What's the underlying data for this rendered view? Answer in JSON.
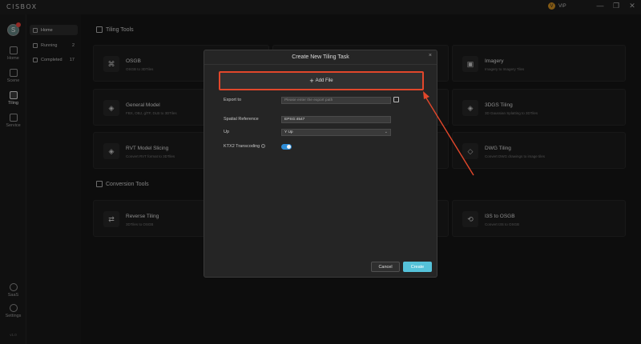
{
  "app": {
    "logo": "CISBOX",
    "vip": "VIP",
    "vip_badge": "V",
    "version": "v1.0"
  },
  "window_controls": [
    "—",
    "❐",
    "✕"
  ],
  "avatar_initial": "S",
  "rail": [
    {
      "label": "Home",
      "icon": "home-icon"
    },
    {
      "label": "Scene",
      "icon": "scene-icon"
    },
    {
      "label": "Tiling",
      "icon": "tiling-icon",
      "active": true
    },
    {
      "label": "Service",
      "icon": "service-icon"
    },
    {
      "label": "SaaS",
      "icon": "saas-icon"
    },
    {
      "label": "Settings",
      "icon": "settings-icon"
    }
  ],
  "subnav": [
    {
      "label": "Home",
      "count": ""
    },
    {
      "label": "Running",
      "count": "2"
    },
    {
      "label": "Completed",
      "count": "17"
    }
  ],
  "sections": {
    "tiling": "Tiling Tools",
    "conversion": "Conversion Tools"
  },
  "cards": [
    {
      "title": "OSGB",
      "sub": "OSGB to 3DTiles",
      "icon": "⌘"
    },
    {
      "title": "Imagery",
      "sub": "Imagery to Imagery Tiles",
      "icon": "▣"
    },
    {
      "title": "General Model",
      "sub": "FBX, OBJ, glTF, DLB to 3DTiles",
      "icon": "◈"
    },
    {
      "title": "3DGS Tiling",
      "sub": "3D Gaussian Splatting to 3DTiles",
      "icon": "◈"
    },
    {
      "title": "RVT Model Slicing",
      "sub": "Convert RVT format to 3DTiles",
      "icon": "◈"
    },
    {
      "title": "DWG Tiling",
      "sub": "Convert DWG drawings to image tiles",
      "icon": "◇"
    },
    {
      "title": "Reverse Tiling",
      "sub": "3DTiles to OSGB",
      "icon": "⇄"
    },
    {
      "title": "I3S to OSGB",
      "sub": "Convert I3S to OSGB",
      "icon": "⟲"
    }
  ],
  "dialog": {
    "title": "Create New Tiling Task",
    "close": "×",
    "add_file": "Add File",
    "plus": "+",
    "export_label": "Export to",
    "export_placeholder": "Please enter the export path",
    "sr_label": "Spatial Reference",
    "sr_value": "EPSG:4547",
    "up_label": "Up",
    "up_value": "Y Up",
    "chevron": "⌄",
    "ktx2_label": "KTX2 Transcoding",
    "info": "i",
    "ktx2_enabled": true,
    "cancel": "Cancel",
    "create": "Create"
  }
}
